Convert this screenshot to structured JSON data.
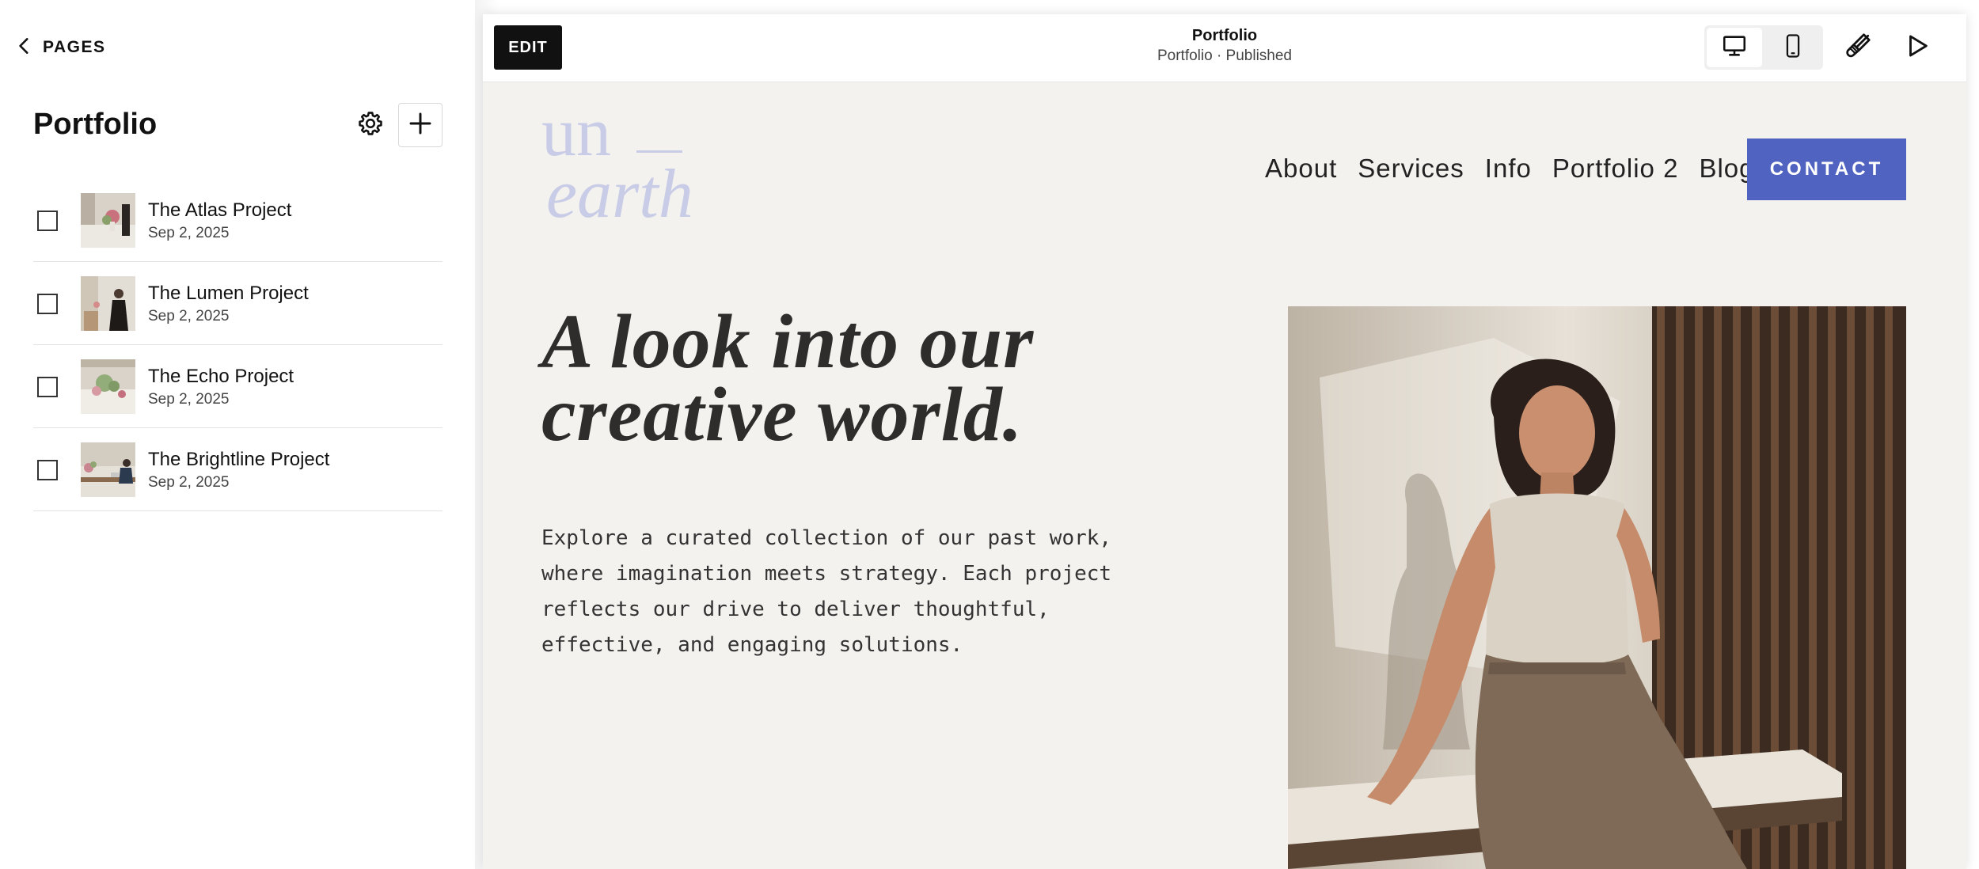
{
  "sidebar": {
    "back_label": "PAGES",
    "title": "Portfolio",
    "items": [
      {
        "title": "The Atlas Project",
        "date": "Sep 2, 2025"
      },
      {
        "title": "The Lumen Project",
        "date": "Sep 2, 2025"
      },
      {
        "title": "The Echo Project",
        "date": "Sep 2, 2025"
      },
      {
        "title": "The Brightline Project",
        "date": "Sep 2, 2025"
      }
    ]
  },
  "topbar": {
    "edit_label": "EDIT",
    "page_title": "Portfolio",
    "page_status": "Portfolio · Published",
    "icons": [
      "desktop-icon",
      "mobile-icon",
      "paintbrush-icon",
      "play-icon"
    ]
  },
  "site": {
    "logo_line1": "un",
    "logo_line2": "earth",
    "nav": [
      "About",
      "Services",
      "Info",
      "Portfolio 2",
      "Blog"
    ],
    "contact_label": "CONTACT",
    "hero_heading": [
      "A look into our",
      "creative world."
    ],
    "hero_body": "Explore a curated collection of our past work, where imagination meets strategy. Each project reflects our drive to deliver thoughtful, effective, and engaging solutions."
  },
  "colors": {
    "accent": "#5163c1",
    "logo": "#c9cce6",
    "site_background": "#f4f2ef",
    "edit_button": "#111111"
  }
}
